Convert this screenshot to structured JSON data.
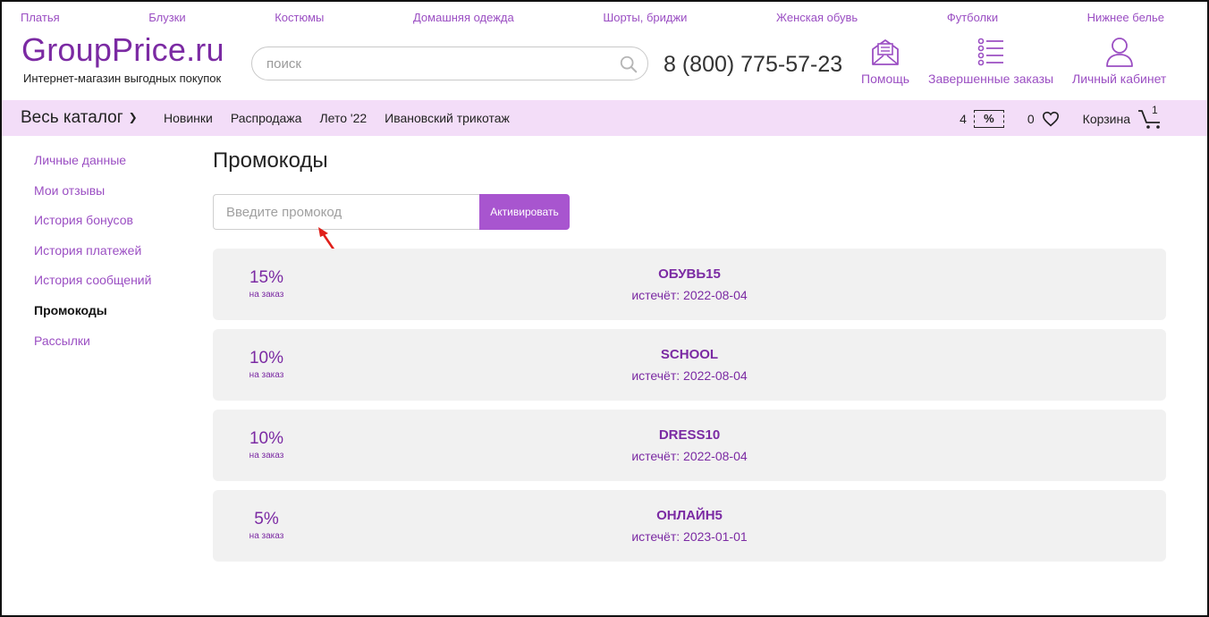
{
  "top_categories": [
    "Платья",
    "Блузки",
    "Костюмы",
    "Домашняя одежда",
    "Шорты, бриджи",
    "Женская обувь",
    "Футболки",
    "Нижнее белье"
  ],
  "header": {
    "logo": "GroupPrice.ru",
    "tagline": "Интернет-магазин выгодных покупок",
    "search_placeholder": "поиск",
    "phone": "8 (800) 775-57-23",
    "help_label": "Помощь",
    "orders_label": "Завершенные заказы",
    "account_label": "Личный кабинет"
  },
  "navbar": {
    "catalog_label": "Весь каталог",
    "links": [
      "Новинки",
      "Распродажа",
      "Лето '22",
      "Ивановский трикотаж"
    ],
    "promo_count": "4",
    "promo_badge": "%",
    "favorites_count": "0",
    "cart_label": "Корзина",
    "cart_count": "1"
  },
  "sidebar": {
    "items": [
      "Личные данные",
      "Мои отзывы",
      "История бонусов",
      "История платежей",
      "История сообщений",
      "Промокоды",
      "Рассылки"
    ],
    "active_index": 5
  },
  "main": {
    "title": "Промокоды",
    "input_placeholder": "Введите промокод",
    "activate_label": "Активировать",
    "promocodes": [
      {
        "discount": "15%",
        "scope": "на заказ",
        "code": "ОБУВЬ15",
        "expires": "истечёт: 2022-08-04"
      },
      {
        "discount": "10%",
        "scope": "на заказ",
        "code": "SCHOOL",
        "expires": "истечёт: 2022-08-04"
      },
      {
        "discount": "10%",
        "scope": "на заказ",
        "code": "DRESS10",
        "expires": "истечёт: 2022-08-04"
      },
      {
        "discount": "5%",
        "scope": "на заказ",
        "code": "ОНЛАЙН5",
        "expires": "истечёт: 2023-01-01"
      }
    ]
  },
  "colors": {
    "accent": "#9b4fc3",
    "button": "#a855cf",
    "navbar_bg": "#f3ddf8",
    "card_bg": "#f1f1f1",
    "annotation_arrow": "#e0201a"
  }
}
